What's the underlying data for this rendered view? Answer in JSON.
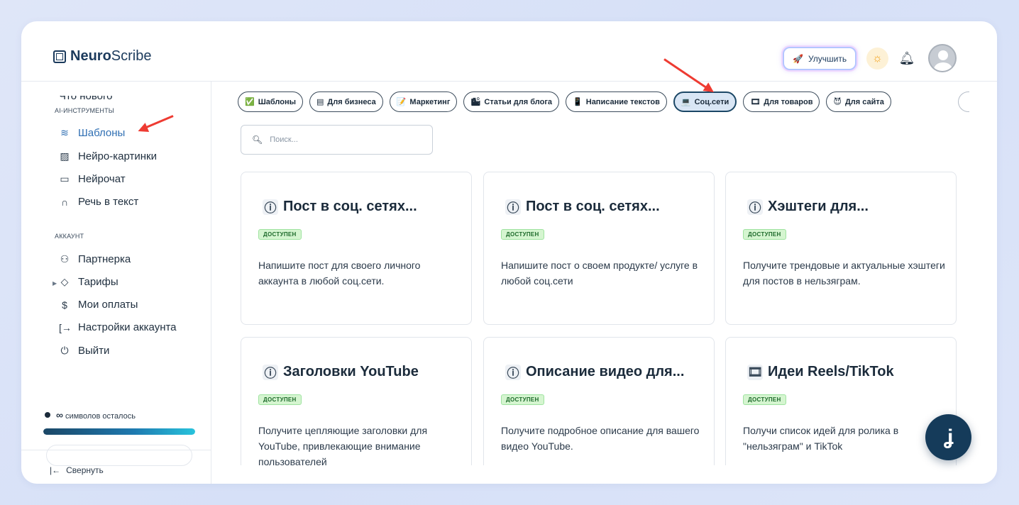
{
  "app": {
    "logo_bold": "Neuro",
    "logo_rest": "Scribe"
  },
  "header": {
    "upgrade_label": "Улучшить"
  },
  "sidebar": {
    "cut_item": "Что нового",
    "sections": {
      "ai_tools": "AI-ИНСТРУМЕНТЫ",
      "account": "АККАУНТ"
    },
    "ai_items": [
      {
        "label": "Шаблоны",
        "icon": "layers-icon"
      },
      {
        "label": "Нейро-картинки",
        "icon": "image-icon"
      },
      {
        "label": "Нейрочат",
        "icon": "chat-icon"
      },
      {
        "label": "Речь в текст",
        "icon": "headphones-icon"
      }
    ],
    "account_items": [
      {
        "label": "Партнерка",
        "icon": "users-icon"
      },
      {
        "label": "Тарифы",
        "icon": "tag-icon"
      },
      {
        "label": "Мои оплаты",
        "icon": "dollar-icon"
      },
      {
        "label": "Настройки аккаунта",
        "icon": "login-icon"
      },
      {
        "label": "Выйти",
        "icon": "power-icon"
      }
    ],
    "symbols_infinity": "∞",
    "symbols_text": "символов осталось",
    "symbols_progress": 1.0,
    "collapse_label": "Свернуть"
  },
  "chips": [
    {
      "label": "Шаблоны",
      "icon": "✅"
    },
    {
      "label": "Для бизнеса",
      "icon": "▤"
    },
    {
      "label": "Маркетинг",
      "icon": "📝"
    },
    {
      "label": "Статьи для блога",
      "icon": "🏙"
    },
    {
      "label": "Написание текстов",
      "icon": "📱"
    },
    {
      "label": "Соц.сети",
      "icon": "💻"
    },
    {
      "label": "Для товаров",
      "icon": "🎞"
    },
    {
      "label": "Для сайта",
      "icon": "😈"
    }
  ],
  "active_chip": "Соц.сети",
  "search": {
    "placeholder": "Поиск..."
  },
  "cards": [
    {
      "title": "Пост в соц. сетях...",
      "badge": "ДОСТУПЕН",
      "desc": "Напишите пост для своего личного аккаунта в любой соц.сети.",
      "icon": "ⓘ"
    },
    {
      "title": "Пост в соц. сетях...",
      "badge": "ДОСТУПЕН",
      "desc": "Напишите пост о своем продукте/ услуге в любой соц.сети",
      "icon": "ⓘ"
    },
    {
      "title": "Хэштеги для...",
      "badge": "ДОСТУПЕН",
      "desc": "Получите трендовые и актуальные хэштеги для постов в нельзяграм.",
      "icon": "ⓘ"
    },
    {
      "title": "Заголовки YouTube",
      "badge": "ДОСТУПЕН",
      "desc": "Получите цепляющие заголовки для YouTube, привлекающие внимание пользователей",
      "icon": "ⓘ"
    },
    {
      "title": "Описание видео для...",
      "badge": "ДОСТУПЕН",
      "desc": "Получите подробное описание для вашего видео YouTube.",
      "icon": "ⓘ"
    },
    {
      "title": "Идеи Reels/TikTok",
      "badge": "ДОСТУПЕН",
      "desc": "Получи список идей для ролика в \"нельзяграм\" и TikTok",
      "icon": "🎞"
    }
  ],
  "chat_button": {
    "icon": "chat-bot-icon",
    "glyph": "ʝ"
  },
  "colors": {
    "accent": "#2f6fb3",
    "brand_dark": "#153b5a",
    "arrow": "#ee3b32",
    "badge_bg": "#d5f5d0"
  }
}
